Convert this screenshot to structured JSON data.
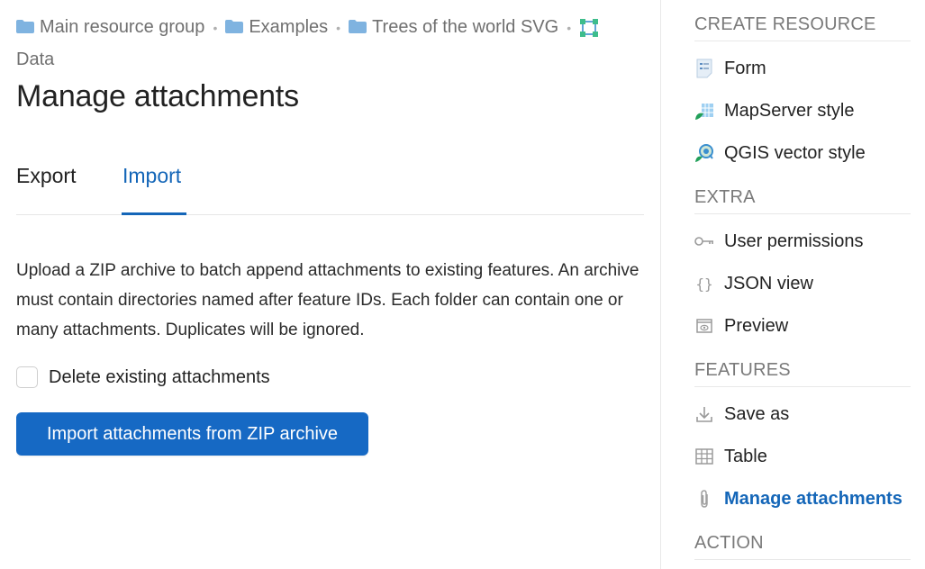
{
  "breadcrumb": {
    "items": [
      {
        "label": "Main resource group",
        "icon": "folder-icon"
      },
      {
        "label": "Examples",
        "icon": "folder-icon"
      },
      {
        "label": "Trees of the world SVG",
        "icon": "folder-icon"
      },
      {
        "label": "Data",
        "icon": "vector-layer-icon"
      }
    ]
  },
  "page": {
    "title": "Manage attachments"
  },
  "tabs": [
    {
      "label": "Export",
      "active": false
    },
    {
      "label": "Import",
      "active": true
    }
  ],
  "import": {
    "description": "Upload a ZIP archive to batch append attachments to existing features. An archive must contain directories named after feature IDs. Each folder can contain one or many attachments. Duplicates will be ignored.",
    "checkbox_label": "Delete existing attachments",
    "checkbox_checked": false,
    "button_label": "Import attachments from ZIP archive"
  },
  "sidebar": {
    "sections": [
      {
        "title": "CREATE RESOURCE",
        "items": [
          {
            "label": "Form",
            "icon": "form-icon"
          },
          {
            "label": "MapServer style",
            "icon": "mapserver-style-icon"
          },
          {
            "label": "QGIS vector style",
            "icon": "qgis-style-icon"
          }
        ]
      },
      {
        "title": "EXTRA",
        "items": [
          {
            "label": "User permissions",
            "icon": "key-icon"
          },
          {
            "label": "JSON view",
            "icon": "braces-icon"
          },
          {
            "label": "Preview",
            "icon": "preview-icon"
          }
        ]
      },
      {
        "title": "FEATURES",
        "items": [
          {
            "label": "Save as",
            "icon": "download-icon"
          },
          {
            "label": "Table",
            "icon": "table-icon"
          },
          {
            "label": "Manage attachments",
            "icon": "paperclip-icon",
            "active": true
          }
        ]
      },
      {
        "title": "ACTION",
        "items": []
      }
    ]
  },
  "colors": {
    "accent": "#1466b8",
    "button": "#1669c4",
    "folder": "#7fb3e0"
  }
}
